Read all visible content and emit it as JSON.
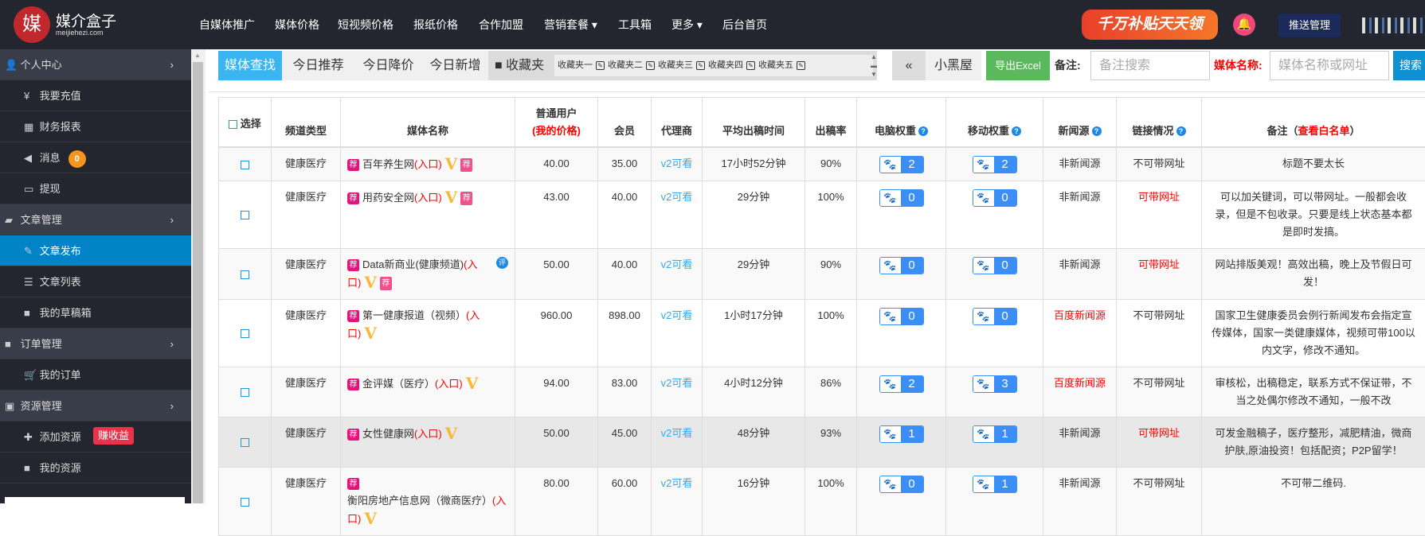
{
  "header": {
    "logo_glyph": "媒",
    "brand": "媒介盒子",
    "domain": "meijiehezi.com",
    "nav": [
      {
        "label": "自媒体推广"
      },
      {
        "label": "媒体价格"
      },
      {
        "label": "短视频价格"
      },
      {
        "label": "报纸价格"
      },
      {
        "label": "合作加盟"
      },
      {
        "label": "营销套餐 ▾"
      },
      {
        "label": "工具箱"
      },
      {
        "label": "更多 ▾"
      },
      {
        "label": "后台首页"
      }
    ],
    "banner": "千万补贴天天领",
    "push": "推送管理"
  },
  "sidebar": {
    "items": [
      {
        "label": "个人中心",
        "icon": "user-icon",
        "glyph": "👤",
        "group": true
      },
      {
        "label": "我要充值",
        "icon": "yen-icon",
        "glyph": "¥"
      },
      {
        "label": "财务报表",
        "icon": "table-icon",
        "glyph": "▦"
      },
      {
        "label": "消息",
        "icon": "speaker-icon",
        "glyph": "◀",
        "badge": "0"
      },
      {
        "label": "提现",
        "icon": "money-icon",
        "glyph": "▭"
      },
      {
        "label": "文章管理",
        "icon": "book-icon",
        "glyph": "▰",
        "group": true
      },
      {
        "label": "文章发布",
        "icon": "edit-icon",
        "glyph": "✎",
        "active": true
      },
      {
        "label": "文章列表",
        "icon": "list-icon",
        "glyph": "☰"
      },
      {
        "label": "我的草稿箱",
        "icon": "video-icon",
        "glyph": "■"
      },
      {
        "label": "订单管理",
        "icon": "folder-icon",
        "glyph": "■",
        "group": true
      },
      {
        "label": "我的订单",
        "icon": "cart-icon",
        "glyph": "🛒"
      },
      {
        "label": "资源管理",
        "icon": "save-icon",
        "glyph": "▣",
        "group": true
      },
      {
        "label": "添加资源",
        "icon": "plus-icon",
        "glyph": "✚",
        "tag": "赚收益"
      },
      {
        "label": "我的资源",
        "icon": "video-icon",
        "glyph": "■"
      }
    ]
  },
  "toolbar": {
    "tabs": [
      "媒体查找",
      "今日推荐",
      "今日降价",
      "今日新增"
    ],
    "fav_label": "收藏夹",
    "favs": [
      "收藏夹一",
      "收藏夹二",
      "收藏夹三",
      "收藏夹四",
      "收藏夹五"
    ],
    "collapse": "«",
    "blacklist": "小黑屋",
    "export": "导出Excel",
    "note_label": "备注:",
    "note_placeholder": "备注搜索",
    "name_label": "媒体名称:",
    "name_placeholder": "媒体名称或网址",
    "search": "搜索"
  },
  "table": {
    "headers": {
      "select": "选择",
      "channel": "频道类型",
      "name": "媒体名称",
      "price1": "普通用户",
      "price2": "(我的价格)",
      "member": "会员",
      "agent": "代理商",
      "time": "平均出稿时间",
      "rate": "出稿率",
      "pc": "电脑权重",
      "mobile": "移动权重",
      "news": "新闻源",
      "link": "链接情况",
      "note": "备注（",
      "note_link": "查看白名单",
      "note_end": "）"
    },
    "rows": [
      {
        "channel": "健康医疗",
        "name": "百年养生网",
        "entry": "(入口)",
        "v": true,
        "jian2": true,
        "price": "40.00",
        "member": "35.00",
        "agent": "v2可看",
        "time": "17小时52分钟",
        "rate": "90%",
        "pc": "2",
        "mobile": "2",
        "news": "非新闻源",
        "link": "不可带网址",
        "note": "标题不要太长"
      },
      {
        "channel": "健康医疗",
        "name": "用药安全网",
        "entry": "(入口)",
        "v": true,
        "jian2": true,
        "price": "43.00",
        "member": "40.00",
        "agent": "v2可看",
        "time": "29分钟",
        "rate": "100%",
        "pc": "0",
        "mobile": "0",
        "news": "非新闻源",
        "link": "可带网址",
        "linkRed": true,
        "note": "可以加关键词，可以带网址。一般都会收录，但是不包收录。只要是线上状态基本都是即时发搞。"
      },
      {
        "channel": "健康医疗",
        "name": "Data新商业(健康频道)",
        "entry": "(入口)",
        "v": true,
        "jian2": true,
        "ping": "评",
        "price": "50.00",
        "member": "40.00",
        "agent": "v2可看",
        "time": "29分钟",
        "rate": "90%",
        "pc": "0",
        "mobile": "0",
        "news": "非新闻源",
        "link": "可带网址",
        "linkRed": true,
        "note": "网站排版美观！高效出稿，晚上及节假日可发！"
      },
      {
        "channel": "健康医疗",
        "name": "第一健康报道（视频）",
        "entry": "(入口)",
        "v": true,
        "price": "960.00",
        "member": "898.00",
        "agent": "v2可看",
        "time": "1小时17分钟",
        "rate": "100%",
        "pc": "0",
        "mobile": "0",
        "news": "百度新闻源",
        "newsRed": true,
        "link": "不可带网址",
        "note": "国家卫生健康委员会例行新闻发布会指定宣传媒体，国家一类健康媒体，视频可带100以内文字，修改不通知。"
      },
      {
        "channel": "健康医疗",
        "name": "金评媒（医疗）",
        "entry": "(入口)",
        "v": true,
        "price": "94.00",
        "member": "83.00",
        "agent": "v2可看",
        "time": "4小时12分钟",
        "rate": "86%",
        "pc": "2",
        "mobile": "3",
        "news": "百度新闻源",
        "newsRed": true,
        "link": "不可带网址",
        "note": "审核松，出稿稳定，联系方式不保证带，不当之处偶尔修改不通知，一般不改"
      },
      {
        "channel": "健康医疗",
        "name": "女性健康网",
        "entry": "(入口)",
        "v": true,
        "price": "50.00",
        "member": "45.00",
        "agent": "v2可看",
        "time": "48分钟",
        "rate": "93%",
        "pc": "1",
        "mobile": "1",
        "news": "非新闻源",
        "link": "可带网址",
        "linkRed": true,
        "note": "可发金融稿子，医疗整形，减肥精油，微商护肤,原油投资！包括配资；P2P留学！"
      },
      {
        "channel": "健康医疗",
        "name": "衡阳房地产信息网（微商医疗）",
        "entry": "(入口)",
        "v": true,
        "brk": true,
        "price": "80.00",
        "member": "60.00",
        "agent": "v2可看",
        "time": "16分钟",
        "rate": "100%",
        "pc": "0",
        "mobile": "1",
        "news": "非新闻源",
        "link": "不可带网址",
        "note": "不可带二维码."
      }
    ]
  },
  "labels": {
    "jian": "荐",
    "v": "V",
    "paw": "🐾",
    "q": "?"
  }
}
